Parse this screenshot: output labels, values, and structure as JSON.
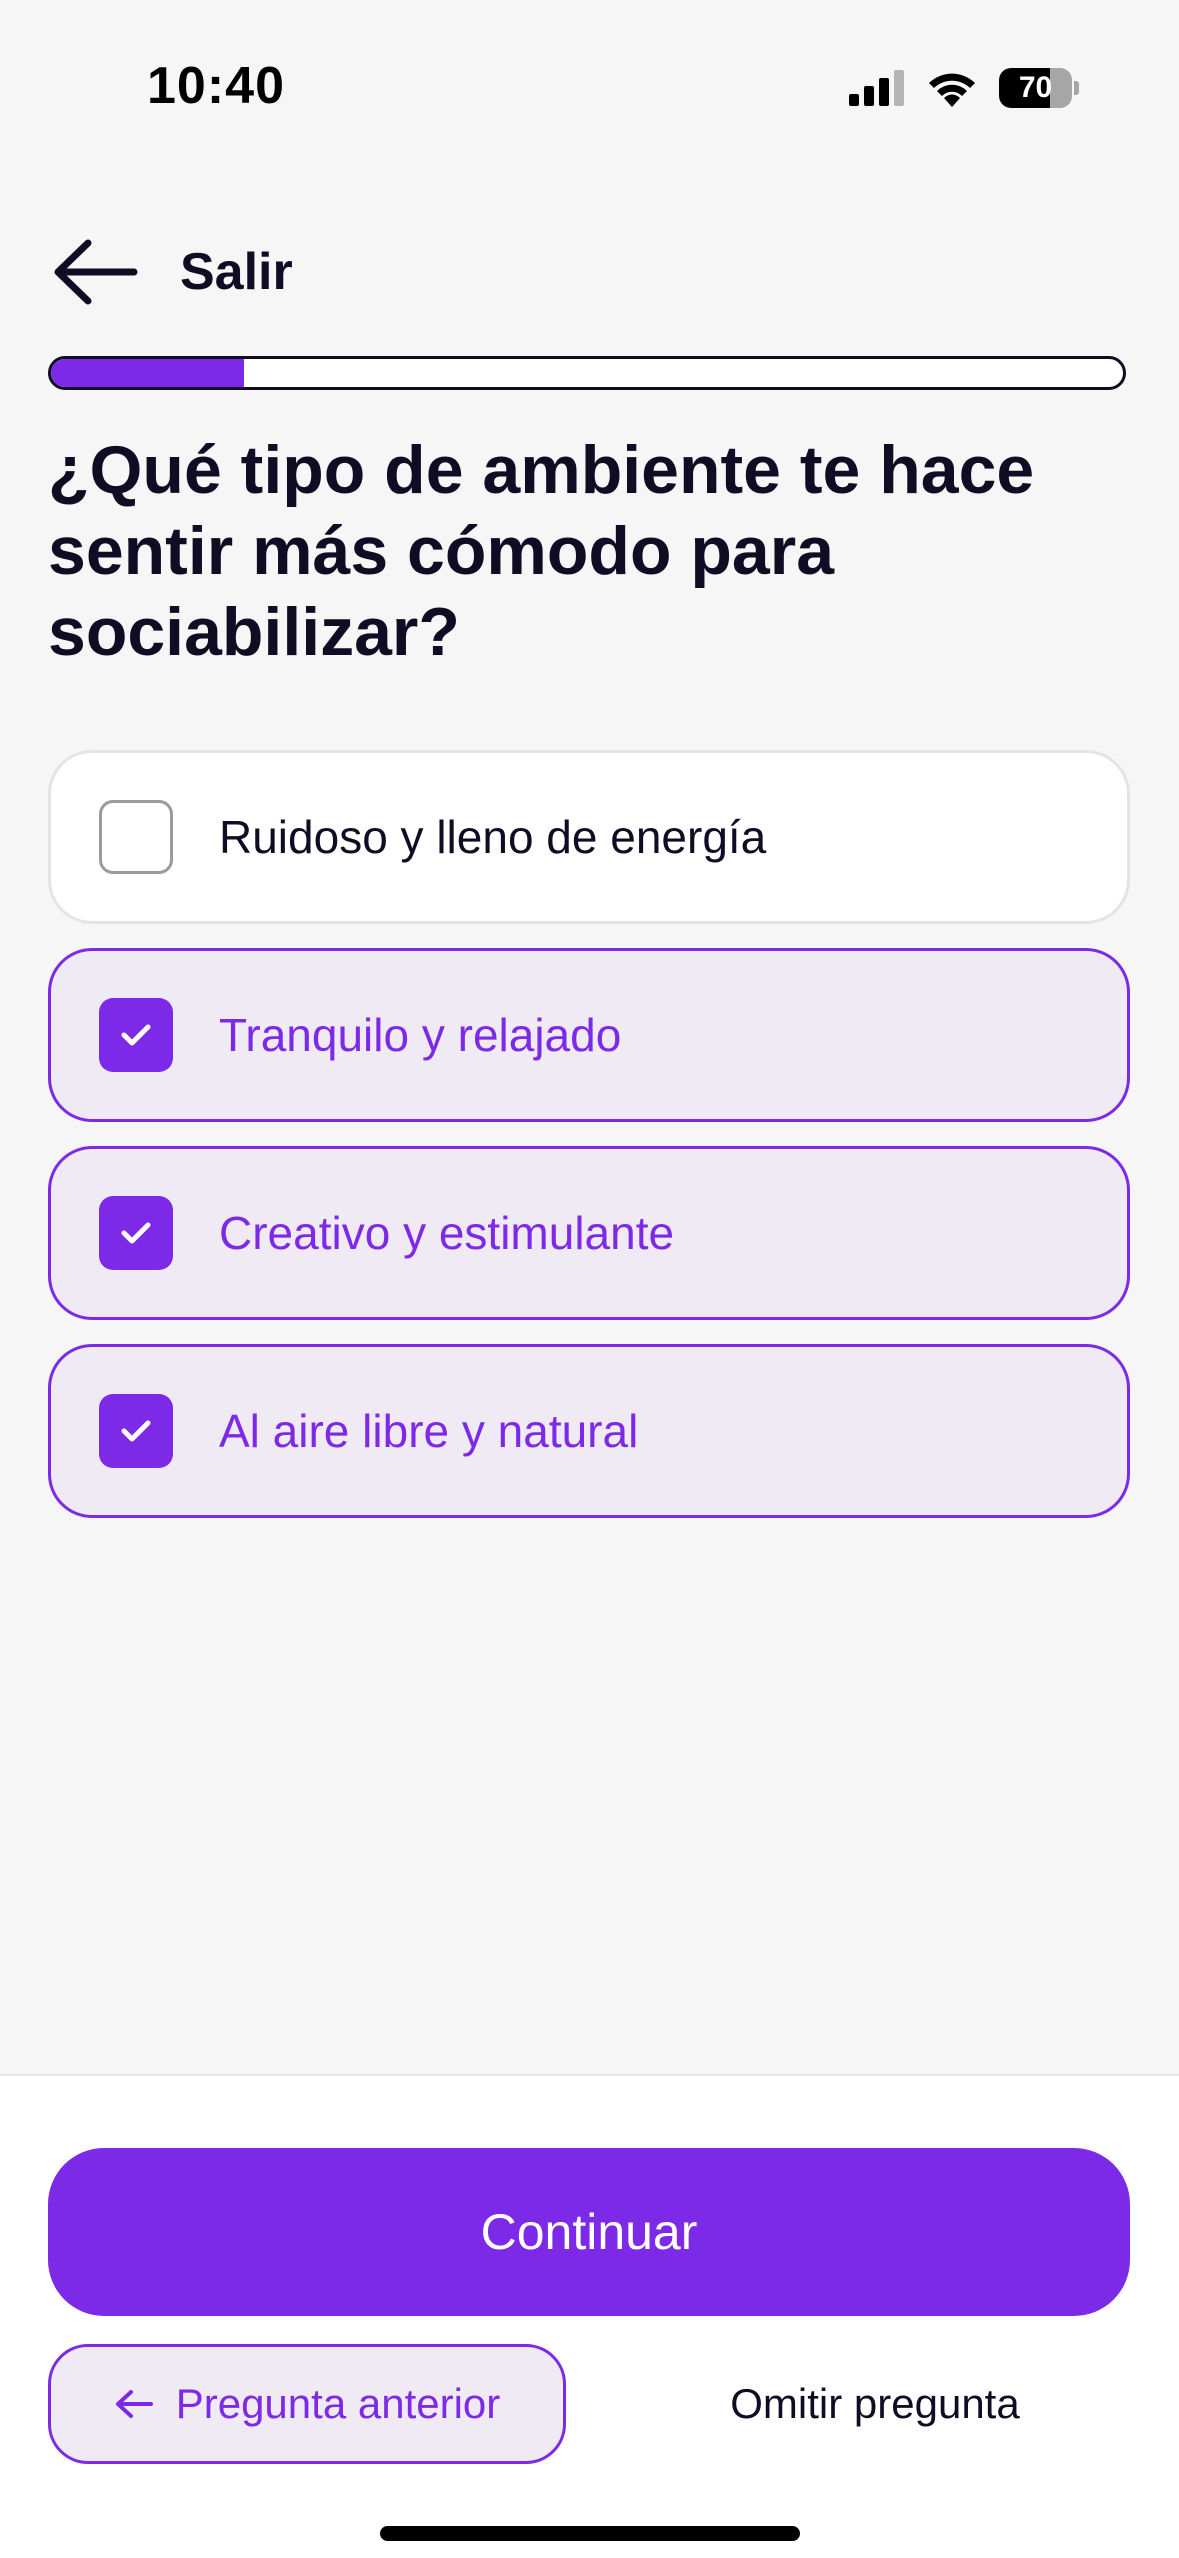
{
  "status_bar": {
    "time": "10:40",
    "battery_level": "70",
    "icons": [
      "cellular-signal-icon",
      "wifi-icon",
      "battery-icon"
    ]
  },
  "header": {
    "back_icon": "arrow-left-icon",
    "back_label": "Salir"
  },
  "progress": {
    "fraction": 0.18
  },
  "question": {
    "title": "¿Qué tipo de ambiente te hace sentir más cómodo para sociabilizar?"
  },
  "options": [
    {
      "label": "Ruidoso y lleno de energía",
      "selected": false
    },
    {
      "label": "Tranquilo y relajado",
      "selected": true
    },
    {
      "label": "Creativo y estimulante",
      "selected": true
    },
    {
      "label": "Al aire libre y natural",
      "selected": true
    }
  ],
  "footer": {
    "continue_label": "Continuar",
    "previous_label": "Pregunta anterior",
    "previous_icon": "arrow-left-icon",
    "skip_label": "Omitir pregunta"
  },
  "colors": {
    "accent": "#7c2ae8",
    "selected_bg": "#f0eaf5",
    "text": "#0f0c24",
    "background": "#f6f6f6"
  }
}
